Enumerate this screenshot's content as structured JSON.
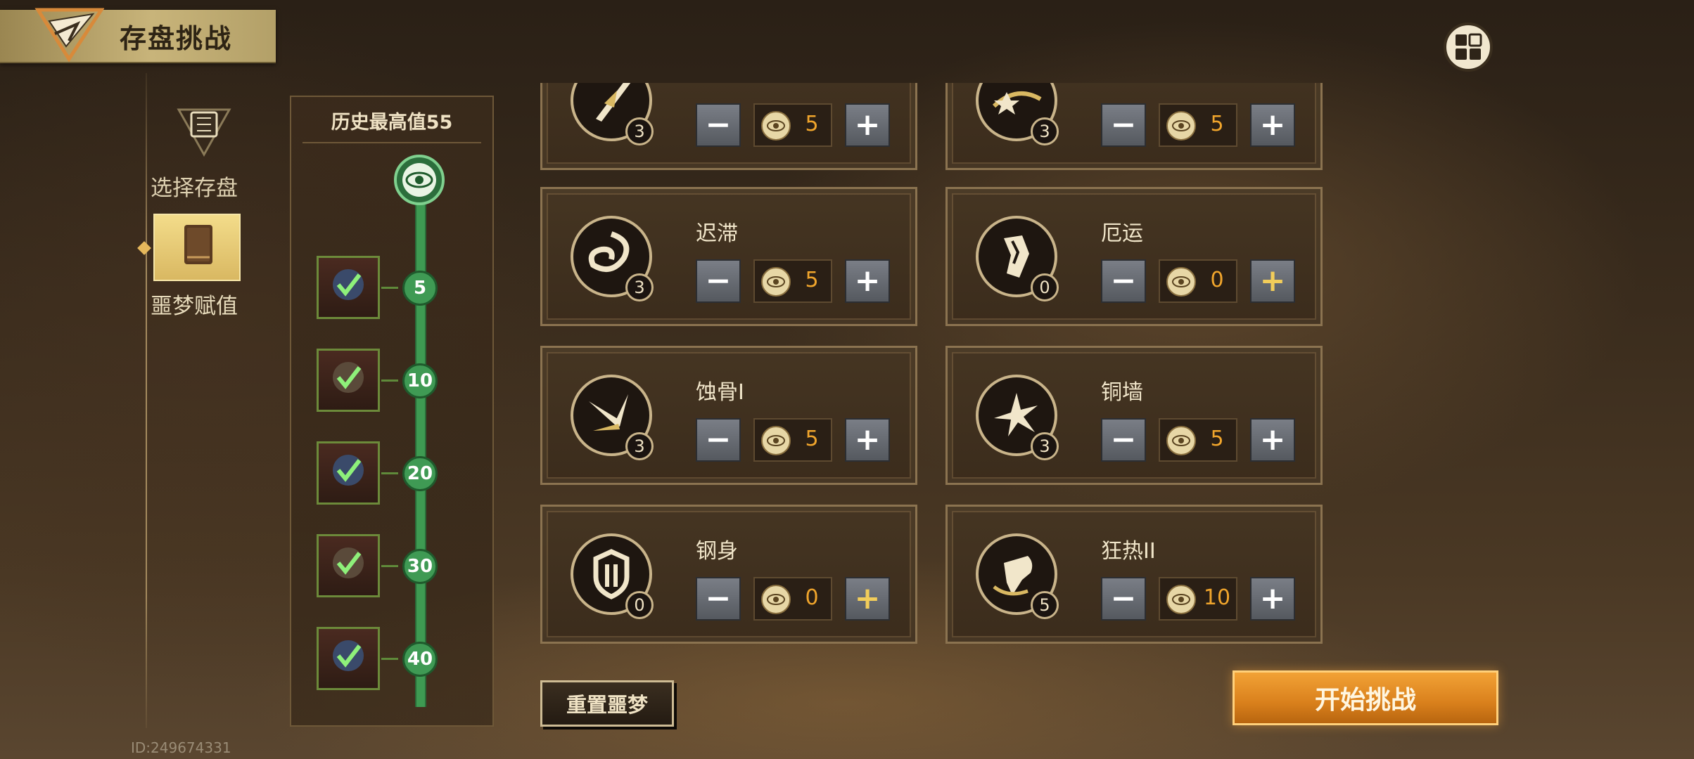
{
  "header": {
    "title": "存盘挑战"
  },
  "nav": {
    "select_save_label": "选择存盘",
    "nightmare_label": "噩梦赋值"
  },
  "history": {
    "title": "历史最高值55",
    "milestones": [
      "5",
      "10",
      "20",
      "30",
      "40"
    ]
  },
  "cards": [
    {
      "name": "",
      "level": "3",
      "value": "5",
      "emblem": "sword-feather-icon",
      "plus_active": false
    },
    {
      "name": "",
      "level": "3",
      "value": "5",
      "emblem": "star-swirl-icon",
      "plus_active": false
    },
    {
      "name": "迟滞",
      "level": "3",
      "value": "5",
      "emblem": "vortex-icon",
      "plus_active": false
    },
    {
      "name": "厄运",
      "level": "0",
      "value": "0",
      "emblem": "shattered-fist-icon",
      "plus_active": true
    },
    {
      "name": "蚀骨I",
      "level": "3",
      "value": "5",
      "emblem": "bone-shard-icon",
      "plus_active": false
    },
    {
      "name": "铜墙",
      "level": "3",
      "value": "5",
      "emblem": "burst-icon",
      "plus_active": false
    },
    {
      "name": "钢身",
      "level": "0",
      "value": "0",
      "emblem": "shield-icon",
      "plus_active": true
    },
    {
      "name": "狂热II",
      "level": "5",
      "value": "10",
      "emblem": "fist-icon",
      "plus_active": false
    }
  ],
  "buttons": {
    "reset_label": "重置噩梦",
    "start_label": "开始挑战"
  },
  "footer": {
    "user_id": "ID:249674331"
  },
  "colors": {
    "value_text": "#f0a52c",
    "track_green": "#3e9a52",
    "start_orange": "#e08a22"
  }
}
